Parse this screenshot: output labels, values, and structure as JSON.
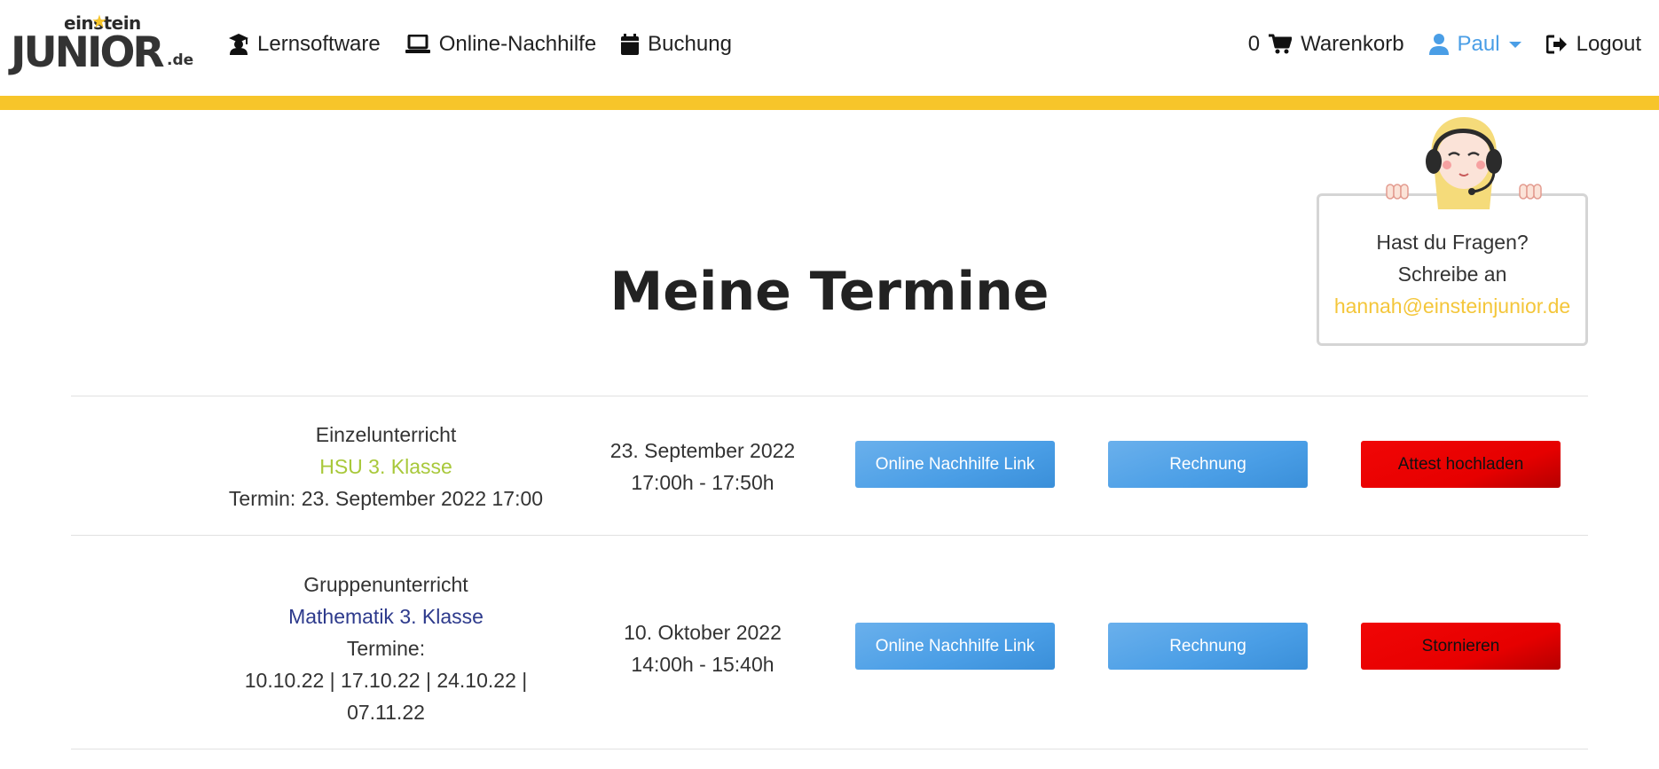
{
  "header": {
    "logo": {
      "top": "einstein",
      "main": "JUNIOR",
      "suffix": ".de"
    },
    "nav_left": [
      {
        "label": "Lernsoftware",
        "icon": "graduate-icon"
      },
      {
        "label": "Online-Nachhilfe",
        "icon": "laptop-icon"
      },
      {
        "label": "Buchung",
        "icon": "calendar-icon"
      }
    ],
    "cart": {
      "count": "0",
      "label": "Warenkorb",
      "icon": "cart-icon"
    },
    "user": {
      "label": "Paul",
      "icon": "user-icon"
    },
    "logout": {
      "label": "Logout",
      "icon": "logout-icon"
    }
  },
  "help": {
    "line1": "Hast du Fragen?",
    "line2": "Schreibe an",
    "email": "hannah@einsteinjunior.de"
  },
  "page": {
    "title": "Meine Termine"
  },
  "appointments": [
    {
      "type": "Einzelunterricht",
      "subject": "HSU 3. Klasse",
      "term_line": "Termin: 23. September 2022 17:00",
      "date": "23. September 2022",
      "time": "17:00h - 17:50h",
      "btn_link": "Online Nachhilfe Link",
      "btn_invoice": "Rechnung",
      "btn_action": "Attest hochladen"
    },
    {
      "type": "Gruppenunterricht",
      "subject": "Mathematik 3. Klasse",
      "term_line": "Termine:",
      "term_dates_1": "10.10.22 | 17.10.22 | 24.10.22 |",
      "term_dates_2": "07.11.22",
      "date": "10. Oktober 2022",
      "time": "14:00h - 15:40h",
      "btn_link": "Online Nachhilfe Link",
      "btn_invoice": "Rechnung",
      "btn_action": "Stornieren"
    }
  ],
  "colors": {
    "accent_yellow": "#f7c52a",
    "button_blue": "#4a9ee6",
    "button_red": "#e60000",
    "subject_green": "#a8c83a",
    "subject_blue": "#2d3a8c"
  }
}
